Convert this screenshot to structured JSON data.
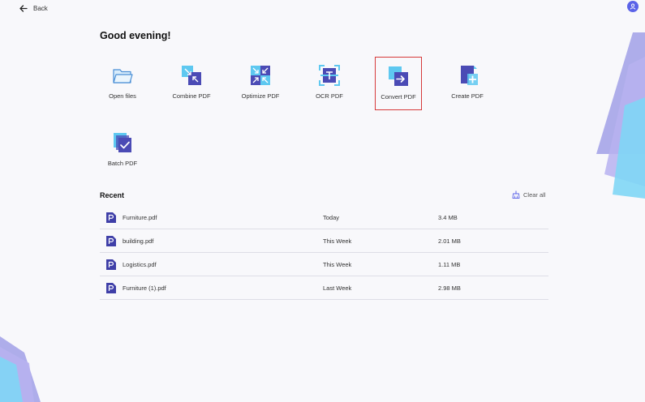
{
  "topbar": {
    "back_label": "Back"
  },
  "greeting": "Good evening!",
  "tools": [
    {
      "label": "Open files",
      "icon": "folder-icon"
    },
    {
      "label": "Combine PDF",
      "icon": "combine-pdf-icon"
    },
    {
      "label": "Optimize PDF",
      "icon": "optimize-pdf-icon"
    },
    {
      "label": "OCR PDF",
      "icon": "ocr-pdf-icon"
    },
    {
      "label": "Convert PDF",
      "icon": "convert-pdf-icon",
      "highlighted": true
    },
    {
      "label": "Create PDF",
      "icon": "create-pdf-icon"
    },
    {
      "label": "Batch PDF",
      "icon": "batch-pdf-icon"
    }
  ],
  "recent": {
    "title": "Recent",
    "clear_label": "Clear all",
    "files": [
      {
        "name": "Furniture.pdf",
        "time": "Today",
        "size": "3.4 MB"
      },
      {
        "name": "building.pdf",
        "time": "This Week",
        "size": "2.01 MB"
      },
      {
        "name": "Logistics.pdf",
        "time": "This Week",
        "size": "1.11 MB"
      },
      {
        "name": "Furniture (1).pdf",
        "time": "Last Week",
        "size": "2.98 MB"
      }
    ]
  },
  "colors": {
    "accent": "#5b63e8",
    "highlight_border": "#d63a3a",
    "icon_dark": "#4b4bb5",
    "icon_light": "#5ec8f0"
  }
}
